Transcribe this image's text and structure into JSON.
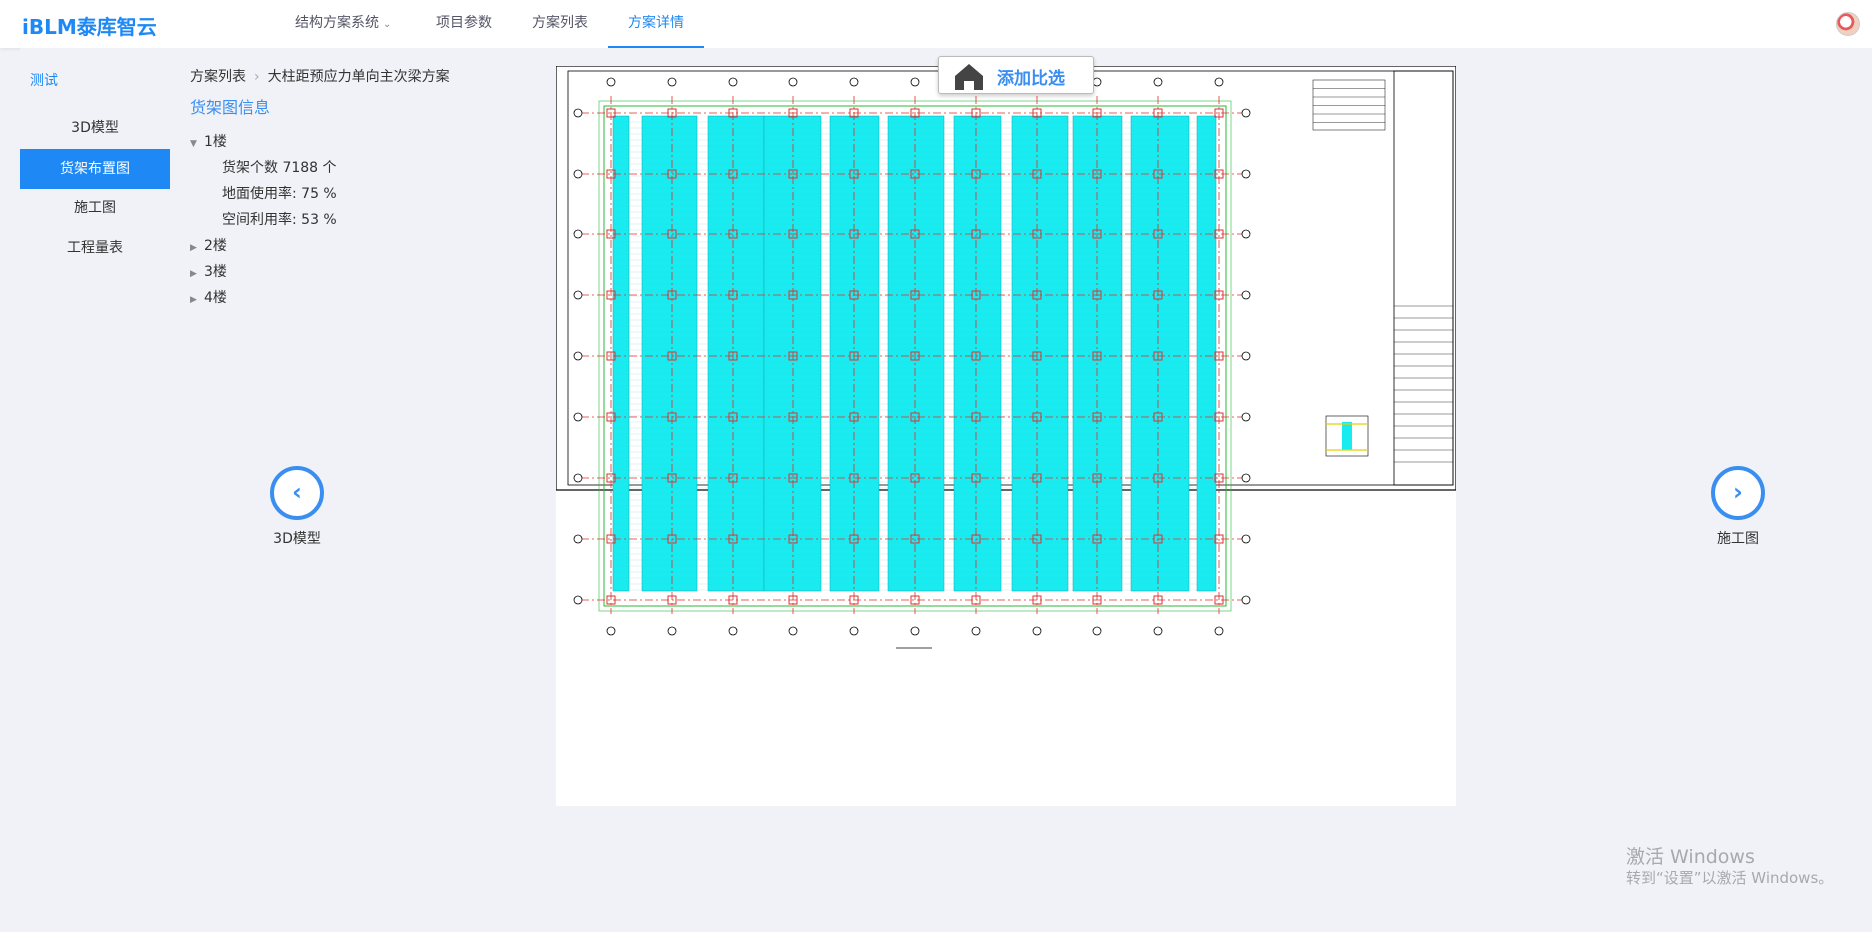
{
  "app": {
    "brand": "iBLM泰库智云"
  },
  "topnav": {
    "items": [
      {
        "label": "结构方案系统",
        "dropdown": true
      },
      {
        "label": "项目参数"
      },
      {
        "label": "方案列表"
      },
      {
        "label": "方案详情",
        "active": true
      }
    ]
  },
  "sidebar": {
    "title": "测试",
    "items": [
      {
        "label": "3D模型"
      },
      {
        "label": "货架布置图",
        "active": true
      },
      {
        "label": "施工图"
      },
      {
        "label": "工程量表"
      }
    ]
  },
  "breadcrumb": {
    "parent": "方案列表",
    "current": "大柱距预应力单向主次梁方案"
  },
  "rack_info": {
    "title": "货架图信息",
    "floors": [
      {
        "label": "1楼",
        "expanded": true,
        "details": [
          "货架个数 7188 个",
          "地面使用率:  75 %",
          "空间利用率:  53 %"
        ]
      },
      {
        "label": "2楼",
        "expanded": false
      },
      {
        "label": "3楼",
        "expanded": false
      },
      {
        "label": "4楼",
        "expanded": false
      }
    ]
  },
  "prev": {
    "label": "3D模型"
  },
  "next": {
    "label": "施工图"
  },
  "compare_button": {
    "label": "添加比选"
  },
  "watermark": {
    "line1": "激活 Windows",
    "line2": "转到“设置”以激活 Windows。"
  },
  "colors": {
    "accent": "#1e88f5",
    "rack_fill": "#19ecf0",
    "grid_red": "#e0302a",
    "grid_green": "#29b83a"
  }
}
